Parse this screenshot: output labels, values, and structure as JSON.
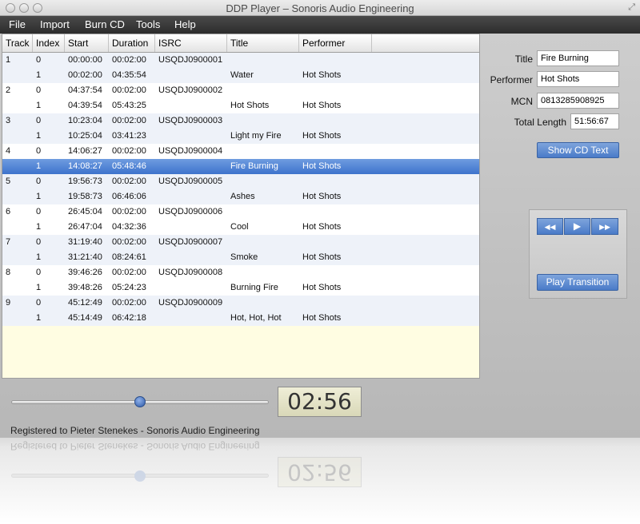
{
  "window": {
    "title": "DDP Player – Sonoris Audio Engineering"
  },
  "menu": [
    "File",
    "Import",
    "Burn CD",
    "Tools",
    "Help"
  ],
  "table": {
    "headers": [
      "Track",
      "Index",
      "Start",
      "Duration",
      "ISRC",
      "Title",
      "Performer"
    ],
    "rows": [
      {
        "track": "1",
        "index": "0",
        "start": "00:00:00",
        "duration": "00:02:00",
        "isrc": "USQDJ0900001",
        "title": "",
        "performer": ""
      },
      {
        "track": "",
        "index": "1",
        "start": "00:02:00",
        "duration": "04:35:54",
        "isrc": "",
        "title": "Water",
        "performer": "Hot Shots"
      },
      {
        "track": "2",
        "index": "0",
        "start": "04:37:54",
        "duration": "00:02:00",
        "isrc": "USQDJ0900002",
        "title": "",
        "performer": ""
      },
      {
        "track": "",
        "index": "1",
        "start": "04:39:54",
        "duration": "05:43:25",
        "isrc": "",
        "title": "Hot Shots",
        "performer": "Hot Shots"
      },
      {
        "track": "3",
        "index": "0",
        "start": "10:23:04",
        "duration": "00:02:00",
        "isrc": "USQDJ0900003",
        "title": "",
        "performer": ""
      },
      {
        "track": "",
        "index": "1",
        "start": "10:25:04",
        "duration": "03:41:23",
        "isrc": "",
        "title": "Light my Fire",
        "performer": "Hot Shots"
      },
      {
        "track": "4",
        "index": "0",
        "start": "14:06:27",
        "duration": "00:02:00",
        "isrc": "USQDJ0900004",
        "title": "",
        "performer": ""
      },
      {
        "track": "",
        "index": "1",
        "start": "14:08:27",
        "duration": "05:48:46",
        "isrc": "",
        "title": "Fire Burning",
        "performer": "Hot Shots",
        "selected": true
      },
      {
        "track": "5",
        "index": "0",
        "start": "19:56:73",
        "duration": "00:02:00",
        "isrc": "USQDJ0900005",
        "title": "",
        "performer": ""
      },
      {
        "track": "",
        "index": "1",
        "start": "19:58:73",
        "duration": "06:46:06",
        "isrc": "",
        "title": "Ashes",
        "performer": "Hot Shots"
      },
      {
        "track": "6",
        "index": "0",
        "start": "26:45:04",
        "duration": "00:02:00",
        "isrc": "USQDJ0900006",
        "title": "",
        "performer": ""
      },
      {
        "track": "",
        "index": "1",
        "start": "26:47:04",
        "duration": "04:32:36",
        "isrc": "",
        "title": "Cool",
        "performer": "Hot Shots"
      },
      {
        "track": "7",
        "index": "0",
        "start": "31:19:40",
        "duration": "00:02:00",
        "isrc": "USQDJ0900007",
        "title": "",
        "performer": ""
      },
      {
        "track": "",
        "index": "1",
        "start": "31:21:40",
        "duration": "08:24:61",
        "isrc": "",
        "title": "Smoke",
        "performer": "Hot Shots"
      },
      {
        "track": "8",
        "index": "0",
        "start": "39:46:26",
        "duration": "00:02:00",
        "isrc": "USQDJ0900008",
        "title": "",
        "performer": ""
      },
      {
        "track": "",
        "index": "1",
        "start": "39:48:26",
        "duration": "05:24:23",
        "isrc": "",
        "title": "Burning Fire",
        "performer": "Hot Shots"
      },
      {
        "track": "9",
        "index": "0",
        "start": "45:12:49",
        "duration": "00:02:00",
        "isrc": "USQDJ0900009",
        "title": "",
        "performer": ""
      },
      {
        "track": "",
        "index": "1",
        "start": "45:14:49",
        "duration": "06:42:18",
        "isrc": "",
        "title": "Hot, Hot, Hot",
        "performer": "Hot Shots"
      }
    ]
  },
  "info": {
    "title_label": "Title",
    "title_value": "Fire Burning",
    "performer_label": "Performer",
    "performer_value": "Hot Shots",
    "mcn_label": "MCN",
    "mcn_value": "0813285908925",
    "length_label": "Total Length",
    "length_value": "51:56:67",
    "show_cd_text": "Show CD Text"
  },
  "transport": {
    "rewind": "◀◀",
    "play": "▶",
    "forward": "▶▶",
    "play_transition": "Play Transition"
  },
  "playback": {
    "position_fraction": 0.5,
    "time": "02:56"
  },
  "status": {
    "registered": "Registered to Pieter Stenekes - Sonoris Audio Engineering"
  },
  "colors": {
    "selection": "#4a7fd0",
    "accent_button": "#5f8ed4",
    "table_empty": "#fffde2"
  }
}
